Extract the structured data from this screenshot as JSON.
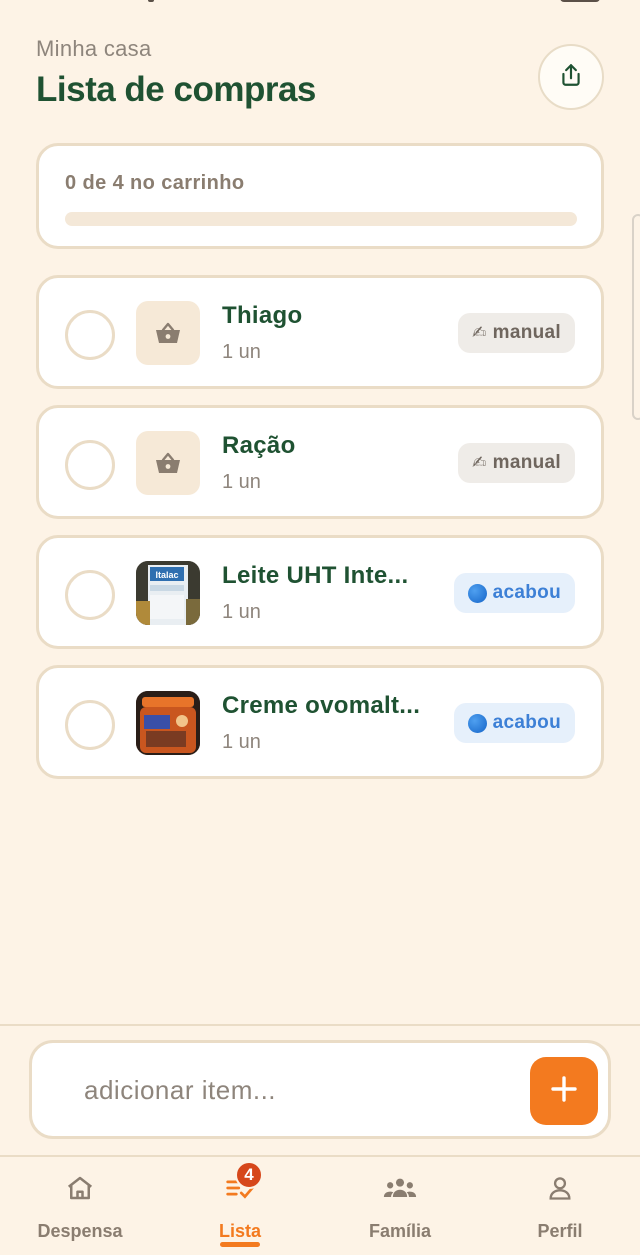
{
  "header": {
    "subtitle": "Minha casa",
    "title": "Lista de compras"
  },
  "share": {
    "icon": "share-icon"
  },
  "progress": {
    "text": "0 de 4 no carrinho",
    "in_cart": 0,
    "total": 4
  },
  "items": [
    {
      "name": "Thiago",
      "qty": "1 un",
      "thumb": "basket-icon",
      "badge_glyph": "✍",
      "badge_label": "manual",
      "badge_type": "manual"
    },
    {
      "name": "Ração",
      "qty": "1 un",
      "thumb": "basket-icon",
      "badge_glyph": "✍",
      "badge_label": "manual",
      "badge_type": "manual"
    },
    {
      "name": "Leite UHT Inte...",
      "qty": "1 un",
      "thumb": "product-photo",
      "badge_glyph": "🔵",
      "badge_label": "acabou",
      "badge_type": "acabou"
    },
    {
      "name": "Creme ovomalt...",
      "qty": "1 un",
      "thumb": "product-photo",
      "badge_glyph": "🔵",
      "badge_label": "acabou",
      "badge_type": "acabou"
    }
  ],
  "product_photo_text": {
    "milk_brand": "Italac"
  },
  "add_bar": {
    "placeholder": "adicionar item...",
    "button_icon": "plus-icon"
  },
  "nav": {
    "items": [
      {
        "label": "Despensa",
        "icon": "home-icon"
      },
      {
        "label": "Lista",
        "icon": "list-check-icon",
        "badge": "4"
      },
      {
        "label": "Família",
        "icon": "family-icon"
      },
      {
        "label": "Perfil",
        "icon": "user-icon"
      }
    ],
    "active_index": 1
  },
  "colors": {
    "background": "#fdf3e6",
    "primary_green": "#1f5232",
    "accent_orange": "#f37a1f",
    "badge_red": "#d6471b",
    "card_border": "#eadcc6"
  }
}
